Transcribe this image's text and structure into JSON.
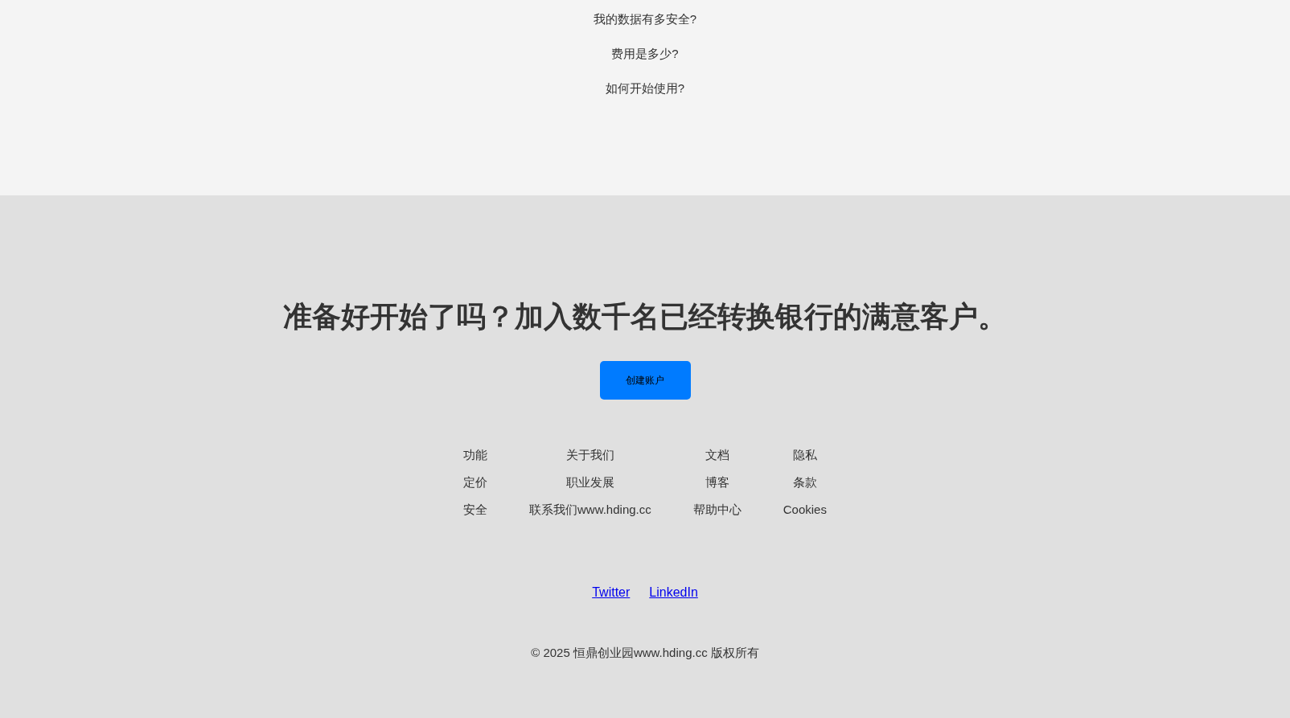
{
  "faq": [
    "我的数据有多安全?",
    "费用是多少?",
    "如何开始使用?"
  ],
  "cta": {
    "heading": "准备好开始了吗？加入数千名已经转换银行的满意客户。",
    "button": "创建账户"
  },
  "footer_columns": [
    [
      "功能",
      "定价",
      "安全"
    ],
    [
      "关于我们",
      "职业发展",
      "联系我们www.hding.cc"
    ],
    [
      "文档",
      "博客",
      "帮助中心"
    ],
    [
      "隐私",
      "条款",
      "Cookies"
    ]
  ],
  "social_links": [
    "Twitter",
    "LinkedIn"
  ],
  "copyright": "© 2025 恒鼎创业园www.hding.cc 版权所有"
}
